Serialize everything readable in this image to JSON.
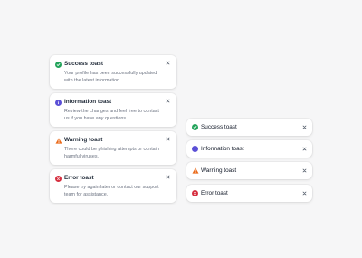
{
  "detailed_toasts": [
    {
      "title": "Success toast",
      "description": "Your profile has been successfully updated with the latest information.",
      "icon": "check-circle-icon",
      "color": "#22a35a"
    },
    {
      "title": "Information toast",
      "description": "Review the changes and feel free to contact us if you have any questions.",
      "icon": "info-circle-icon",
      "color": "#5b4fd6"
    },
    {
      "title": "Warning toast",
      "description": "There could be phishing attempts or contain harmful viruses.",
      "icon": "warning-triangle-icon",
      "color": "#ea6a1a"
    },
    {
      "title": "Error toast",
      "description": "Please try again later or contact our support team for assistance.",
      "icon": "error-circle-icon",
      "color": "#d63040"
    }
  ],
  "compact_toasts": [
    {
      "title": "Success toast",
      "icon": "check-circle-icon",
      "color": "#22a35a"
    },
    {
      "title": "Information toast",
      "icon": "info-circle-icon",
      "color": "#5b4fd6"
    },
    {
      "title": "Warning toast",
      "icon": "warning-triangle-icon",
      "color": "#ea6a1a"
    },
    {
      "title": "Error toast",
      "icon": "error-circle-icon",
      "color": "#d63040"
    }
  ],
  "close_icon": "close-icon"
}
